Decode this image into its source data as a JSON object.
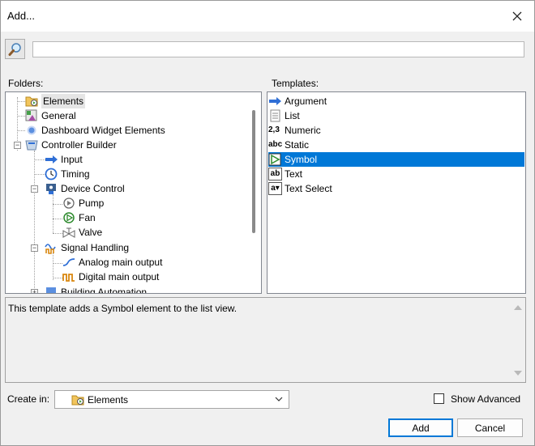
{
  "window": {
    "title": "Add..."
  },
  "search": {
    "placeholder": "",
    "value": ""
  },
  "labels": {
    "folders": "Folders:",
    "templates": "Templates:",
    "create_in": "Create in:",
    "show_advanced": "Show Advanced"
  },
  "folders": [
    {
      "label": "Elements",
      "icon": "folder-elements-icon",
      "selected": true
    },
    {
      "label": "General",
      "icon": "general-icon"
    },
    {
      "label": "Dashboard Widget Elements",
      "icon": "dashboard-widget-icon"
    },
    {
      "label": "Controller Builder",
      "icon": "controller-builder-icon",
      "expanded": true
    },
    {
      "label": "Input",
      "icon": "arrow-right-icon"
    },
    {
      "label": "Timing",
      "icon": "clock-icon"
    },
    {
      "label": "Device Control",
      "icon": "device-control-icon",
      "expanded": true
    },
    {
      "label": "Pump",
      "icon": "pump-icon"
    },
    {
      "label": "Fan",
      "icon": "fan-icon"
    },
    {
      "label": "Valve",
      "icon": "valve-icon"
    },
    {
      "label": "Signal Handling",
      "icon": "signal-handling-icon",
      "expanded": true
    },
    {
      "label": "Analog main output",
      "icon": "analog-wave-icon"
    },
    {
      "label": "Digital main output",
      "icon": "digital-pulse-icon"
    },
    {
      "label": "Building Automation",
      "icon": "building-icon"
    }
  ],
  "templates": [
    {
      "label": "Argument",
      "icon": "argument-arrow-icon"
    },
    {
      "label": "List",
      "icon": "list-icon"
    },
    {
      "label": "Numeric",
      "icon": "numeric-icon",
      "glyph": "2,3"
    },
    {
      "label": "Static",
      "icon": "static-text-icon",
      "glyph": "abc"
    },
    {
      "label": "Symbol",
      "icon": "symbol-play-icon",
      "selected": true
    },
    {
      "label": "Text",
      "icon": "text-icon",
      "glyph": "ab"
    },
    {
      "label": "Text Select",
      "icon": "text-select-icon",
      "glyph": "a▾"
    }
  ],
  "description": "This template adds a Symbol element to the list view.",
  "create_in": {
    "value": "Elements",
    "icon": "folder-elements-icon"
  },
  "show_advanced": {
    "checked": false
  },
  "buttons": {
    "add": "Add",
    "cancel": "Cancel"
  },
  "colors": {
    "selection": "#0078d7",
    "accent_blue": "#2f6fd6",
    "folder_yellow": "#f2c55c"
  }
}
